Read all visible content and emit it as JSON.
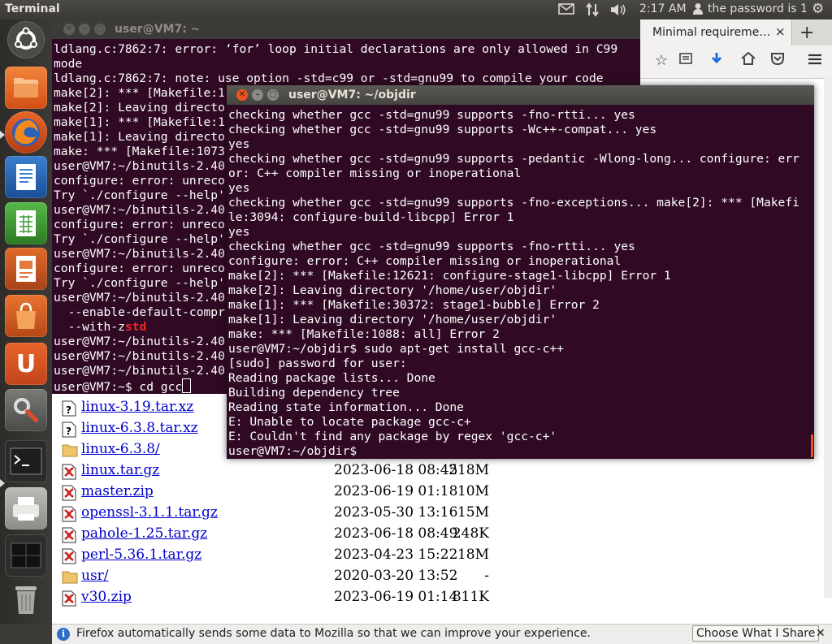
{
  "top_panel": {
    "app_title": "Terminal",
    "clock": "2:17 AM",
    "user_label": "the password is 1"
  },
  "launcher": {
    "items": [
      "dash-home",
      "files",
      "firefox",
      "writer",
      "calc",
      "impress",
      "software-center",
      "ubuntu-one",
      "system-settings",
      "terminal",
      "printer",
      "workspace-switcher",
      "trash"
    ]
  },
  "firefox": {
    "tab_title": "Minimal requireme…",
    "tab_close": "×",
    "new_tab": "+",
    "files": [
      {
        "name": "linux-3.19.tar.xz",
        "date": "",
        "size": "",
        "icon": "unknown-file-icon"
      },
      {
        "name": "linux-6.3.8.tar.xz",
        "date": "",
        "size": "",
        "icon": "unknown-file-icon"
      },
      {
        "name": "linux-6.3.8/",
        "date": "",
        "size": "",
        "icon": "folder-icon"
      },
      {
        "name": "linux.tar.gz",
        "date": "2023-06-18 08:45",
        "size": "218M",
        "icon": "archive-icon"
      },
      {
        "name": "master.zip",
        "date": "2023-06-19 01:18",
        "size": "10M",
        "icon": "archive-icon"
      },
      {
        "name": "openssl-3.1.1.tar.gz",
        "date": "2023-05-30 13:16",
        "size": "15M",
        "icon": "archive-icon"
      },
      {
        "name": "pahole-1.25.tar.gz",
        "date": "2023-06-18 08:49",
        "size": "248K",
        "icon": "archive-icon"
      },
      {
        "name": "perl-5.36.1.tar.gz",
        "date": "2023-04-23 15:22",
        "size": "18M",
        "icon": "archive-icon"
      },
      {
        "name": "usr/",
        "date": "2020-03-20 13:52",
        "size": "-",
        "icon": "folder-icon"
      },
      {
        "name": "v30.zip",
        "date": "2023-06-19 01:14",
        "size": "811K",
        "icon": "archive-icon"
      }
    ],
    "notification": {
      "message": "Firefox automatically sends some data to Mozilla so that we can improve your experience.",
      "button": "Choose What I Share",
      "close": "✕"
    }
  },
  "terminal_back": {
    "title": "user@VM7: ~",
    "lines": [
      "ldlang.c:7862:7: error: ‘for’ loop initial declarations are only allowed in C99",
      "mode",
      "ldlang.c:7862:7: note: use option -std=c99 or -std=gnu99 to compile your code",
      "make[2]: *** [Makefile:1",
      "make[2]: Leaving directo",
      "make[1]: *** [Makefile:1",
      "make[1]: Leaving directo",
      "make: *** [Makefile:1073",
      "user@VM7:~/binutils-2.40",
      "configure: error: unreco",
      "Try `./configure --help'",
      "user@VM7:~/binutils-2.40",
      "configure: error: unreco",
      "Try `./configure --help'",
      "user@VM7:~/binutils-2.40",
      "configure: error: unreco",
      "Try `./configure --help'",
      "user@VM7:~/binutils-2.40",
      "  --enable-default-compr",
      "  --with-z",
      "user@VM7:~/binutils-2.40",
      "user@VM7:~/binutils-2.40",
      "user@VM7:~/binutils-2.40"
    ],
    "red_fragment": "std",
    "prompt_line": "user@VM7:~$ cd gcc"
  },
  "terminal_front": {
    "title": "user@VM7: ~/objdir",
    "lines": [
      "checking whether gcc -std=gnu99 supports -fno-rtti... yes",
      "checking whether gcc -std=gnu99 supports -Wc++-compat... yes",
      "yes",
      "checking whether gcc -std=gnu99 supports -pedantic -Wlong-long... configure: err",
      "or: C++ compiler missing or inoperational",
      "yes",
      "checking whether gcc -std=gnu99 supports -fno-exceptions... make[2]: *** [Makefi",
      "le:3094: configure-build-libcpp] Error 1",
      "yes",
      "checking whether gcc -std=gnu99 supports -fno-rtti... yes",
      "configure: error: C++ compiler missing or inoperational",
      "make[2]: *** [Makefile:12621: configure-stage1-libcpp] Error 1",
      "make[2]: Leaving directory '/home/user/objdir'",
      "make[1]: *** [Makefile:30372: stage1-bubble] Error 2",
      "make[1]: Leaving directory '/home/user/objdir'",
      "make: *** [Makefile:1088: all] Error 2",
      "user@VM7:~/objdir$ sudo apt-get install gcc-c++",
      "[sudo] password for user:",
      "Reading package lists... Done",
      "Building dependency tree",
      "Reading state information... Done",
      "E: Unable to locate package gcc-c+",
      "E: Couldn't find any package by regex 'gcc-c+'",
      "user@VM7:~/objdir$"
    ]
  },
  "colors": {
    "terminal_bg": "#300a24",
    "terminal_fg": "#ffffff",
    "link": "#0000cc"
  }
}
